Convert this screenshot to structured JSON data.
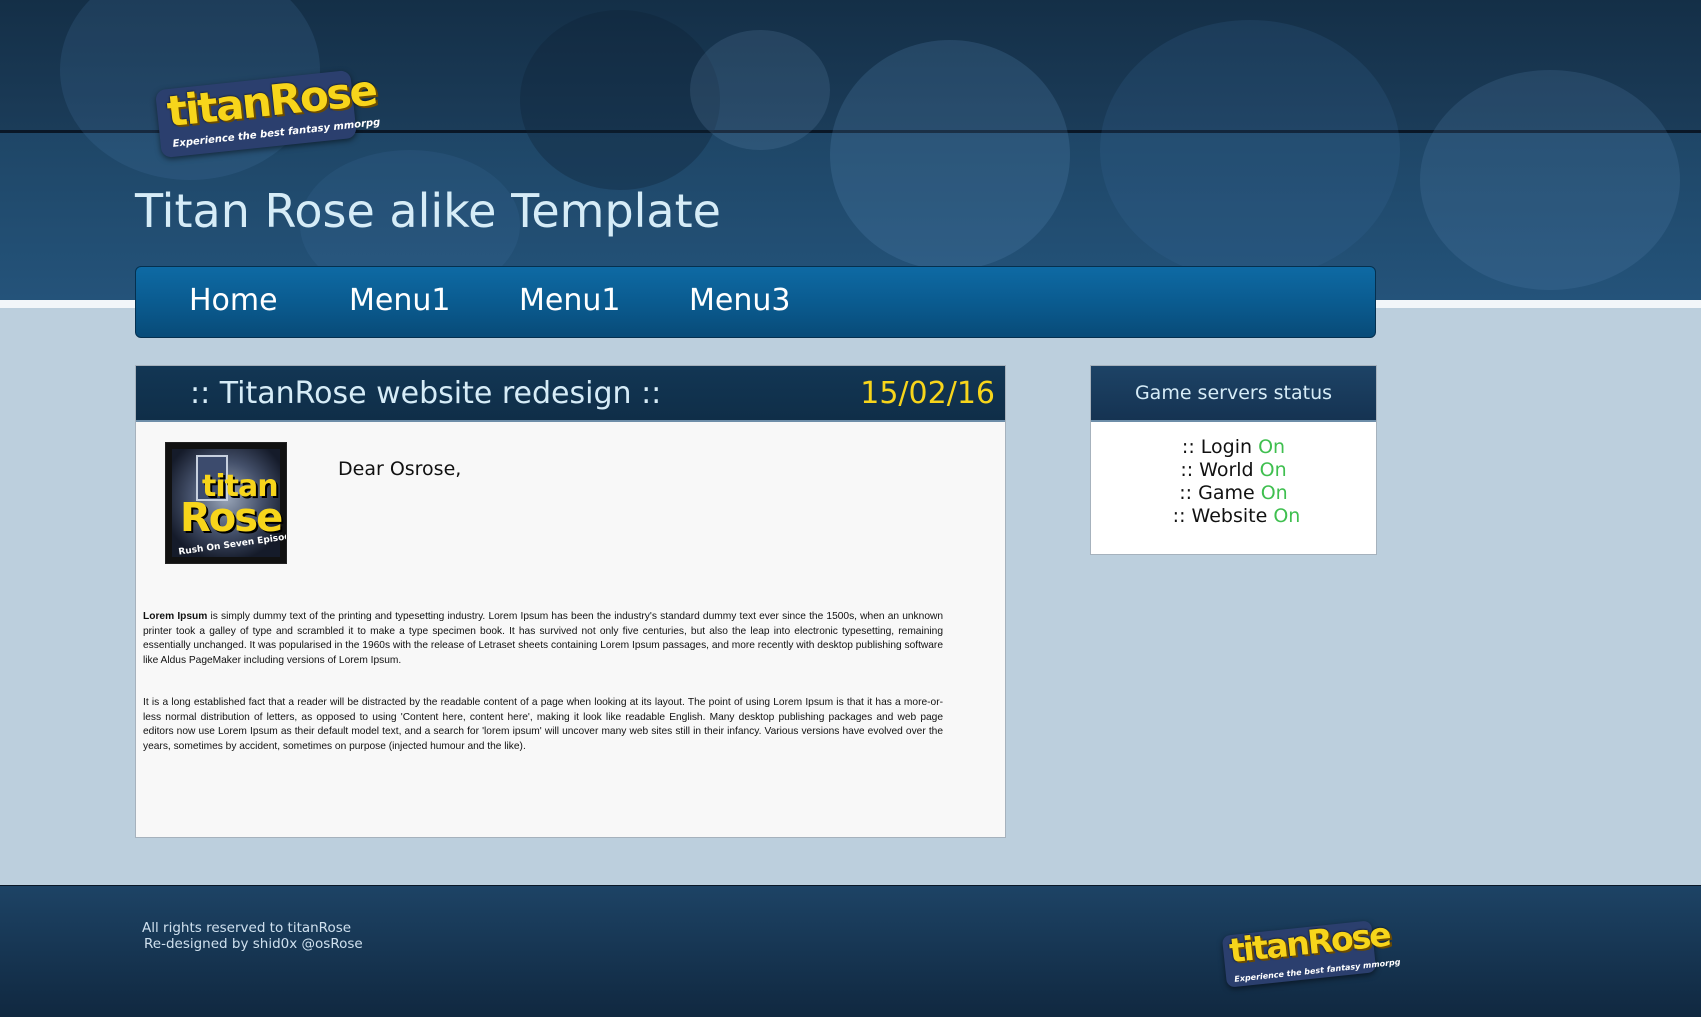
{
  "header": {
    "logo": {
      "word": "titanRose",
      "tagline": "Experience the best fantasy mmorpg"
    },
    "site_title": "Titan Rose alike Template"
  },
  "nav": {
    "items": [
      {
        "label": "Home"
      },
      {
        "label": "Menu1"
      },
      {
        "label": "Menu1"
      },
      {
        "label": "Menu3"
      }
    ]
  },
  "article": {
    "title": "::  TitanRose website redesign  ::",
    "date": "15/02/16",
    "thumbnail": {
      "word_top": "titan",
      "word_bottom": "Rose",
      "tagline": "Rush On Seven Episodes"
    },
    "greeting": "Dear Osrose,",
    "paragraph1_lead": "Lorem Ipsum",
    "paragraph1_rest": " is simply dummy text of the printing and typesetting industry. Lorem Ipsum has been the industry's standard dummy text ever since the 1500s, when an unknown printer took a galley of type and scrambled it to make a type specimen book. It has survived not only five centuries, but also the leap into electronic typesetting, remaining essentially unchanged. It was popularised in the 1960s with the release of Letraset sheets containing Lorem Ipsum passages, and more recently with desktop publishing software like Aldus PageMaker including versions of Lorem Ipsum.",
    "paragraph2": "It is a long established fact that a reader will be distracted by the readable content of a page when looking at its layout. The point of using Lorem Ipsum is that it has a more-or-less normal distribution of letters, as opposed to using 'Content here, content here', making it look like readable English. Many desktop publishing packages and web page editors now use Lorem Ipsum as their default model text, and a search for 'lorem ipsum' will uncover many web sites still in their infancy. Various versions have evolved over the years, sometimes by accident, sometimes on purpose (injected humour and the like)."
  },
  "status": {
    "title": "Game servers status",
    "servers": [
      {
        "label": ":: Login",
        "state": "On"
      },
      {
        "label": ":: World",
        "state": "On"
      },
      {
        "label": ":: Game",
        "state": "On"
      },
      {
        "label": ":: Website",
        "state": "On"
      }
    ],
    "on_color": "#3fbf4f"
  },
  "footer": {
    "line1": "All rights reserved to titanRose",
    "line2": "Re-designed by shid0x @osRose",
    "logo": {
      "word": "titanRose",
      "tagline": "Experience the best fantasy mmorpg"
    }
  },
  "colors": {
    "accent_yellow": "#f7d51b",
    "nav_blue": "#0a5a8e",
    "page_bg": "#bccfdd"
  }
}
